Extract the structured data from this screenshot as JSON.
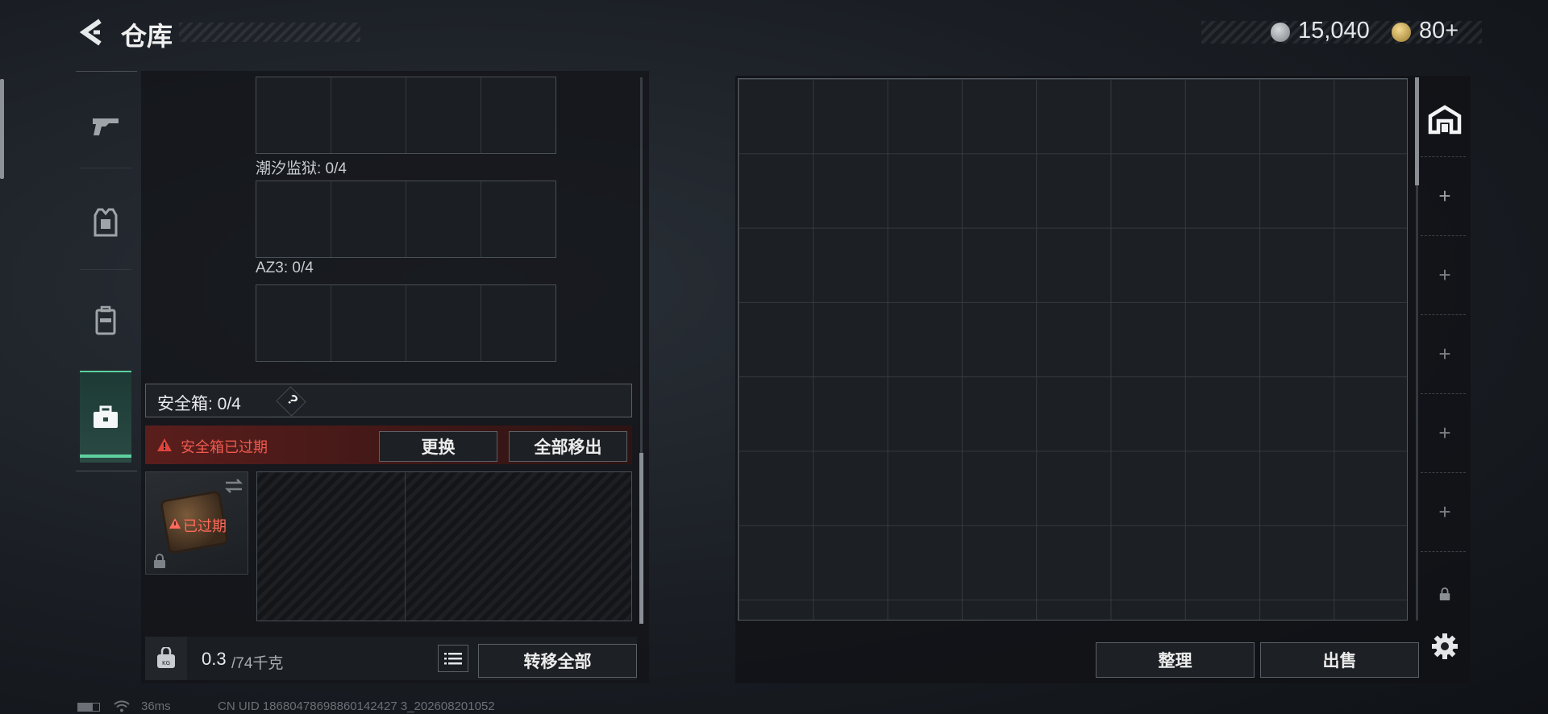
{
  "header": {
    "title": "仓库",
    "currency_silver": "15,040",
    "currency_gold": "80+"
  },
  "nav_tabs": [
    {
      "name": "firearms",
      "icon": "pistol-icon"
    },
    {
      "name": "armor",
      "icon": "armor-vest-icon"
    },
    {
      "name": "backpack",
      "icon": "backpack-icon"
    },
    {
      "name": "secure-case",
      "icon": "briefcase-icon",
      "active": true
    }
  ],
  "left_panel": {
    "slot_groups": [
      {
        "label": ""
      },
      {
        "label": "潮汐监狱: 0/4"
      },
      {
        "label": "AZ3: 0/4"
      }
    ],
    "safe_box": {
      "label": "安全箱: 0/4",
      "help": "?",
      "expired_warning": "安全箱已过期",
      "replace_button": "更换",
      "remove_all_button": "全部移出",
      "item_status": "已过期"
    },
    "footer": {
      "weight_current": "0.3",
      "weight_max": "/74千克",
      "transfer_all_button": "转移全部"
    }
  },
  "right_panel": {
    "grid_cols": 9,
    "grid_rows": 7,
    "sort_button": "整理",
    "sell_button": "出售"
  },
  "right_rail": {
    "items": [
      "warehouse-icon",
      "plus-icon",
      "plus-icon",
      "plus-icon",
      "plus-icon",
      "plus-icon",
      "lock-icon"
    ]
  },
  "status_bar": {
    "ping": "36ms",
    "uid": "CN UID 18680478698860142427 3_202608201052"
  },
  "colors": {
    "accent_green": "#5fd0a0",
    "warning_red": "#e0443c",
    "expired_text": "#ff6a5c"
  }
}
